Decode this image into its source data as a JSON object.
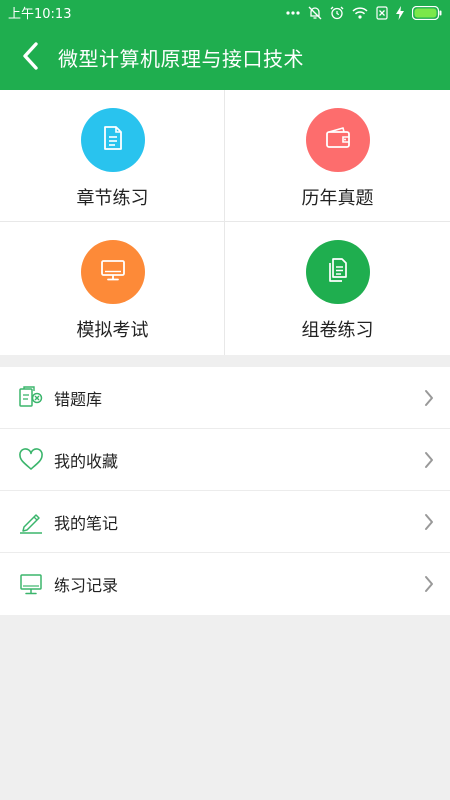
{
  "status_bar": {
    "time": "上午10:13"
  },
  "header": {
    "title": "微型计算机原理与接口技术"
  },
  "grid": [
    {
      "label": "章节练习",
      "icon": "document-icon",
      "color": "#29c3ee"
    },
    {
      "label": "历年真题",
      "icon": "wallet-icon",
      "color": "#fd6d6d"
    },
    {
      "label": "模拟考试",
      "icon": "monitor-icon",
      "color": "#fd8a38"
    },
    {
      "label": "组卷练习",
      "icon": "papers-icon",
      "color": "#1fae4f"
    }
  ],
  "menu": [
    {
      "label": "错题库",
      "icon": "wrong-questions-icon"
    },
    {
      "label": "我的收藏",
      "icon": "heart-icon"
    },
    {
      "label": "我的笔记",
      "icon": "pencil-icon"
    },
    {
      "label": "练习记录",
      "icon": "history-icon"
    }
  ],
  "colors": {
    "brand": "#1fae4f",
    "icon_green": "#3bb56c"
  }
}
